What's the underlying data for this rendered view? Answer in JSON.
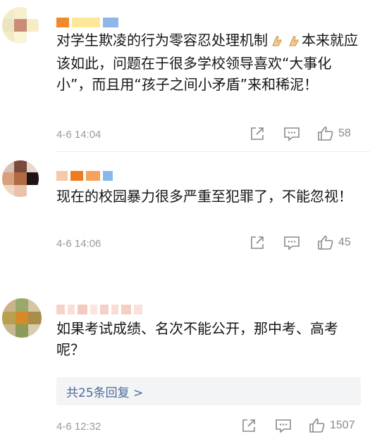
{
  "comments": [
    {
      "text": "对学生欺凌的行为零容忍处理机制",
      "text_after": "本来就应该如此，问题在于很多学校领导喜欢“大事化小”，而且用“孩子之间小矛盾”来和稀泥！",
      "emoji": "folded-hands",
      "time": "4-6 14:04",
      "likes": "58",
      "avatar_colors": [
        "#f1ecc8",
        "#f6f0d0",
        "#ffffff",
        "#ece4c0",
        "#c98c76",
        "#f6ecc6",
        "#f2ebc4",
        "#fbf5d8",
        "#ffffff"
      ],
      "name_colors": [
        "#f08a2a",
        "#ffe79a",
        "#8fb6e8"
      ]
    },
    {
      "text": "现在的校园暴力很多严重至犯罪了，不能忽视！",
      "time": "4-6 14:06",
      "likes": "45",
      "avatar_colors": [
        "#d9c2b5",
        "#7a4a3e",
        "#e9d8cf",
        "#d6a07e",
        "#b26a44",
        "#1e1414",
        "#f2d6c4",
        "#e8c3aa",
        "#ffffff"
      ],
      "name_colors": [
        "#f6c9a8",
        "#f07a1f",
        "#f5a25c",
        "#88b8ea"
      ]
    },
    {
      "text": "如果考试成绩、名次不能公开，那中考、高考呢？",
      "time": "4-6 12:32",
      "likes": "1507",
      "replies_label": "共25条回复 >",
      "avatar_colors": [
        "#c9b48a",
        "#9aa86a",
        "#d8c6a0",
        "#b8a04e",
        "#d58a2a",
        "#a88e4a",
        "#c7b88e",
        "#8c9a5a",
        "#d6ccb0"
      ],
      "name_colors": [
        "#f7d2c6",
        "#f9dfd6",
        "#f4cabd",
        "#fae6de",
        "#f6d0c4",
        "#f9ddd3",
        "#f5cfc2",
        "#f8e2da"
      ]
    }
  ],
  "icons": {
    "share": "share-icon",
    "comment": "comment-icon",
    "like": "like-icon",
    "emoji": "folded-hands-icon"
  }
}
